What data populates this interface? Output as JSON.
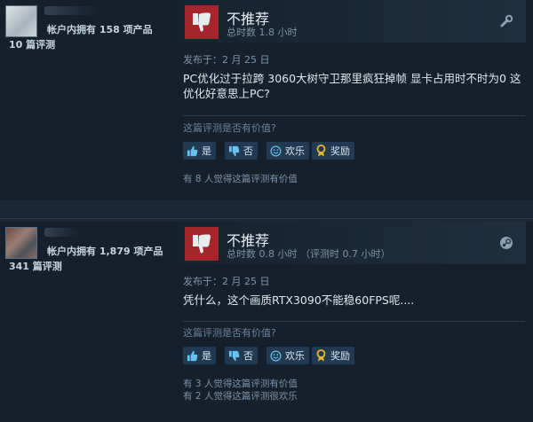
{
  "reviews": [
    {
      "products_owned": "帐户内拥有 158 项产品",
      "review_count": "10 篇评测",
      "verdict": "不推荐",
      "hours": "总时数 1.8 小时",
      "posted": "发布于：2 月 25 日",
      "content": "PC优化过于拉跨 3060大树守卫那里疯狂掉帧 显卡占用时不时为0 这优化好意思上PC?",
      "helpful_question": "这篇评测是否有价值?",
      "buttons": {
        "yes": "是",
        "no": "否",
        "funny": "欢乐",
        "award": "奖励"
      },
      "votes": [
        "有 8 人觉得这篇评测有价值"
      ],
      "corner_icon": "wrench-icon"
    },
    {
      "products_owned": "帐户内拥有 1,879 项产品",
      "review_count": "341 篇评测",
      "verdict": "不推荐",
      "hours": "总时数 0.8 小时 （评测时 0.7 小时）",
      "posted": "发布于：2 月 25 日",
      "content": "凭什么，这个画质RTX3090不能稳60FPS呢....",
      "helpful_question": "这篇评测是否有价值?",
      "buttons": {
        "yes": "是",
        "no": "否",
        "funny": "欢乐",
        "award": "奖励"
      },
      "votes": [
        "有 3 人觉得这篇评测有价值",
        "有 2 人觉得这篇评测很欢乐"
      ],
      "corner_icon": "steam-logo-icon"
    }
  ],
  "colors": {
    "thumb_down_bg": "#a3262c",
    "page_bg": "#1b2838",
    "button_bg": "#213a52",
    "award_yellow": "#e8b62a"
  }
}
